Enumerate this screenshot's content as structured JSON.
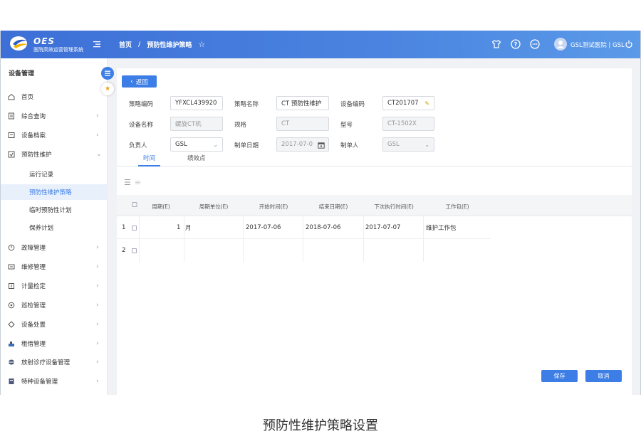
{
  "header": {
    "brand_name": "OES",
    "brand_subtitle": "医院高效运营管理系统",
    "breadcrumb": [
      "首页",
      "/",
      "预防性维护策略"
    ],
    "user_name": "GSL测试医院 | GSL"
  },
  "sidebar": {
    "title": "设备管理",
    "items": [
      {
        "label": "首页",
        "icon": "home-icon",
        "arrow": ""
      },
      {
        "label": "综合查询",
        "icon": "document-icon",
        "arrow": "›"
      },
      {
        "label": "设备档案",
        "icon": "archive-icon",
        "arrow": "›"
      },
      {
        "label": "预防性维护",
        "icon": "maintenance-icon",
        "arrow": "⌄"
      },
      {
        "label": "故障管理",
        "icon": "fault-icon",
        "arrow": "›"
      },
      {
        "label": "维修管理",
        "icon": "repair-icon",
        "arrow": "›"
      },
      {
        "label": "计量检定",
        "icon": "measure-icon",
        "arrow": "›"
      },
      {
        "label": "巡检管理",
        "icon": "inspection-icon",
        "arrow": "›"
      },
      {
        "label": "设备处置",
        "icon": "disposal-icon",
        "arrow": "›"
      },
      {
        "label": "租借管理",
        "icon": "lease-icon",
        "arrow": "›"
      },
      {
        "label": "放射诊疗设备管理",
        "icon": "radiation-icon",
        "arrow": "›"
      },
      {
        "label": "特种设备管理",
        "icon": "special-icon",
        "arrow": "›"
      }
    ],
    "subitems": [
      "运行记录",
      "预防性维护策略",
      "临时预防性计划",
      "保养计划"
    ]
  },
  "form": {
    "back_label": "返回",
    "policy_code_label": "策略编码",
    "policy_code": "YFXCL439920",
    "policy_name_label": "策略名称",
    "policy_name": "CT 预防性维护",
    "device_code_label": "设备编码",
    "device_code": "CT201707",
    "device_name_label": "设备名称",
    "device_name": "螺旋CT机",
    "spec_label": "规格",
    "spec": "CT",
    "model_label": "型号",
    "model": "CT-1502X",
    "owner_label": "负责人",
    "owner": "GSL",
    "date_label": "制单日期",
    "date": "2017-07-0",
    "creator_label": "制单人",
    "creator": "GSL"
  },
  "tabs": [
    "时间",
    "绩效点"
  ],
  "table": {
    "columns": [
      "周期(E)",
      "周期单位(E)",
      "开始时间(E)",
      "结束日期(E)",
      "下次执行时间(E)",
      "工作包(E)"
    ],
    "rows": [
      {
        "no": "1",
        "cycle": "1",
        "unit": "月",
        "start": "2017-07-06",
        "end": "2018-07-06",
        "next": "2017-07-07",
        "package": "维护工作包"
      },
      {
        "no": "2",
        "cycle": "",
        "unit": "",
        "start": "",
        "end": "",
        "next": "",
        "package": ""
      }
    ]
  },
  "actions": {
    "save": "保存",
    "cancel": "取消"
  },
  "caption": "预防性维护策略设置",
  "colors": {
    "accent": "#3d7ee6",
    "header_start": "#3d6fd6",
    "header_end": "#5b9ae8"
  }
}
